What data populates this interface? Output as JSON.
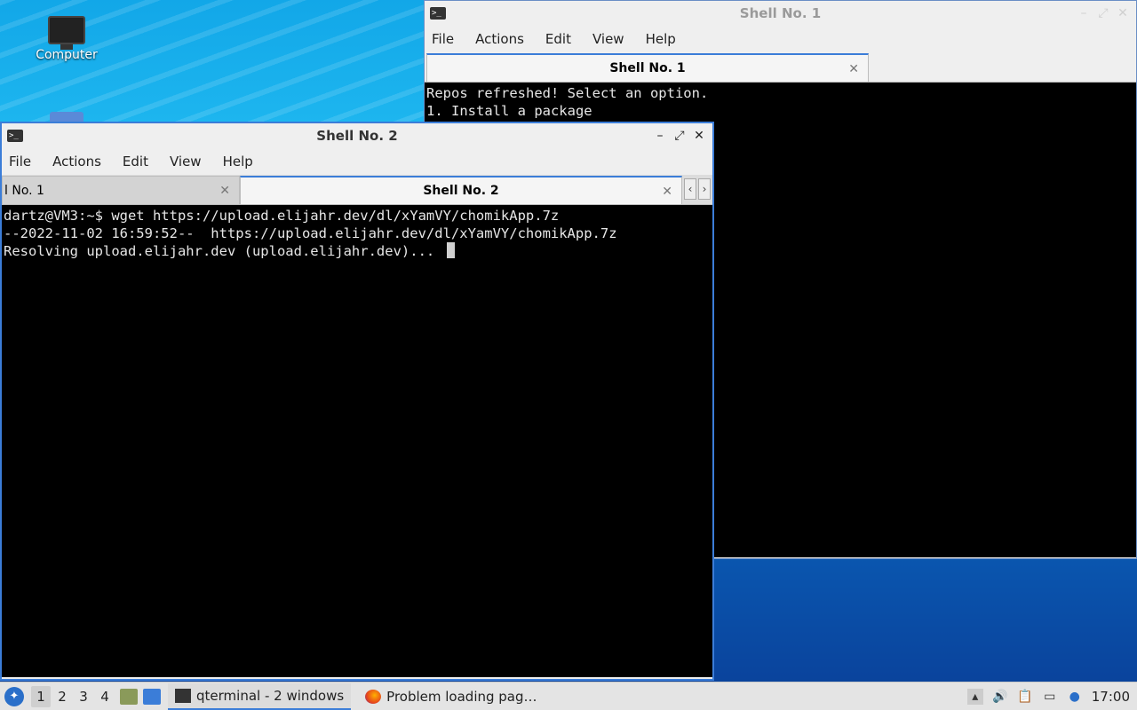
{
  "desktop": {
    "icons": [
      {
        "label": "Computer"
      }
    ]
  },
  "window1": {
    "title": "Shell No. 1",
    "menu": [
      "File",
      "Actions",
      "Edit",
      "View",
      "Help"
    ],
    "tab_label": "Shell No. 1",
    "terminal_lines": [
      "Repos refreshed! Select an option.",
      "1. Install a package"
    ]
  },
  "window2": {
    "title": "Shell No. 2",
    "menu": [
      "File",
      "Actions",
      "Edit",
      "View",
      "Help"
    ],
    "tabs": [
      {
        "label": "l No. 1",
        "active": false
      },
      {
        "label": "Shell No. 2",
        "active": true
      }
    ],
    "terminal_lines": [
      "dartz@VM3:~$ wget https://upload.elijahr.dev/dl/xYamVY/chomikApp.7z",
      "--2022-11-02 16:59:52--  https://upload.elijahr.dev/dl/xYamVY/chomikApp.7z",
      "Resolving upload.elijahr.dev (upload.elijahr.dev)... "
    ]
  },
  "taskbar": {
    "workspaces": [
      "1",
      "2",
      "3",
      "4"
    ],
    "active_workspace": "1",
    "tasks": [
      {
        "label": "qterminal - 2 windows",
        "icon": "terminal-icon",
        "active": true
      },
      {
        "label": "Problem loading pag…",
        "icon": "firefox-icon",
        "active": false
      }
    ],
    "clock": "17:00"
  },
  "colors": {
    "accent": "#3b7dd8",
    "terminal_bg": "#000000",
    "terminal_fg": "#e6e6e6"
  }
}
